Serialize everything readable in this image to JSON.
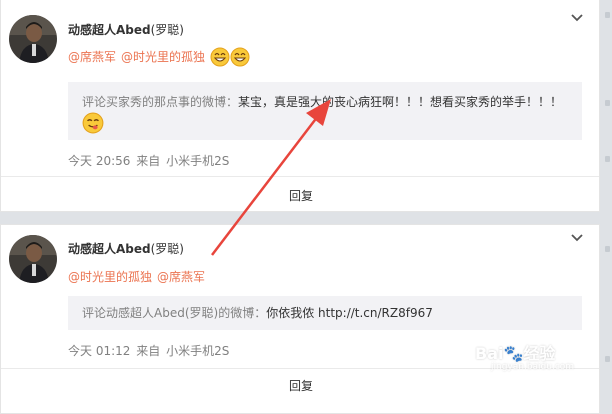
{
  "posts": [
    {
      "username": "动感超人Abed",
      "remark": "(罗聪)",
      "mentions": [
        "@席燕军",
        "@时光里的孤独"
      ],
      "emojis": [
        "grin-emoji",
        "grin-emoji"
      ],
      "quote_source": "评论买家秀的那点事的微博：",
      "quote_text": "某宝，真是强大的丧心病狂啊！！！想看买家秀的举手！！！",
      "quote_emoji": "yum-emoji",
      "time": "今天 20:56",
      "source_prefix": "来自",
      "device": "小米手机2S",
      "reply_label": "回复"
    },
    {
      "username": "动感超人Abed",
      "remark": "(罗聪)",
      "mentions": [
        "@时光里的孤独",
        "@席燕军"
      ],
      "quote_source": "评论动感超人Abed(罗聪)的微博：",
      "quote_text": "你依我侬 http://t.cn/RZ8f967",
      "time": "今天 01:12",
      "source_prefix": "来自",
      "device": "小米手机2S",
      "reply_label": "回复"
    }
  ],
  "annotation": {
    "color": "#e8453c"
  },
  "watermark": {
    "brand": "Bai",
    "brand_suffix": "经验",
    "url": "jingyan.baidu.com"
  }
}
